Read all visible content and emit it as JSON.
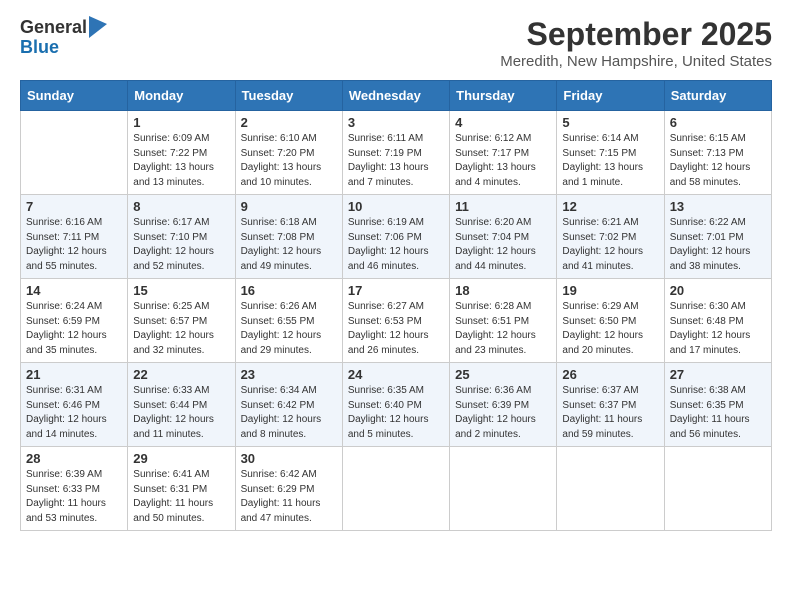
{
  "logo": {
    "general": "General",
    "blue": "Blue"
  },
  "title": "September 2025",
  "location": "Meredith, New Hampshire, United States",
  "days_of_week": [
    "Sunday",
    "Monday",
    "Tuesday",
    "Wednesday",
    "Thursday",
    "Friday",
    "Saturday"
  ],
  "weeks": [
    [
      {
        "day": "",
        "info": ""
      },
      {
        "day": "1",
        "info": "Sunrise: 6:09 AM\nSunset: 7:22 PM\nDaylight: 13 hours\nand 13 minutes."
      },
      {
        "day": "2",
        "info": "Sunrise: 6:10 AM\nSunset: 7:20 PM\nDaylight: 13 hours\nand 10 minutes."
      },
      {
        "day": "3",
        "info": "Sunrise: 6:11 AM\nSunset: 7:19 PM\nDaylight: 13 hours\nand 7 minutes."
      },
      {
        "day": "4",
        "info": "Sunrise: 6:12 AM\nSunset: 7:17 PM\nDaylight: 13 hours\nand 4 minutes."
      },
      {
        "day": "5",
        "info": "Sunrise: 6:14 AM\nSunset: 7:15 PM\nDaylight: 13 hours\nand 1 minute."
      },
      {
        "day": "6",
        "info": "Sunrise: 6:15 AM\nSunset: 7:13 PM\nDaylight: 12 hours\nand 58 minutes."
      }
    ],
    [
      {
        "day": "7",
        "info": "Sunrise: 6:16 AM\nSunset: 7:11 PM\nDaylight: 12 hours\nand 55 minutes."
      },
      {
        "day": "8",
        "info": "Sunrise: 6:17 AM\nSunset: 7:10 PM\nDaylight: 12 hours\nand 52 minutes."
      },
      {
        "day": "9",
        "info": "Sunrise: 6:18 AM\nSunset: 7:08 PM\nDaylight: 12 hours\nand 49 minutes."
      },
      {
        "day": "10",
        "info": "Sunrise: 6:19 AM\nSunset: 7:06 PM\nDaylight: 12 hours\nand 46 minutes."
      },
      {
        "day": "11",
        "info": "Sunrise: 6:20 AM\nSunset: 7:04 PM\nDaylight: 12 hours\nand 44 minutes."
      },
      {
        "day": "12",
        "info": "Sunrise: 6:21 AM\nSunset: 7:02 PM\nDaylight: 12 hours\nand 41 minutes."
      },
      {
        "day": "13",
        "info": "Sunrise: 6:22 AM\nSunset: 7:01 PM\nDaylight: 12 hours\nand 38 minutes."
      }
    ],
    [
      {
        "day": "14",
        "info": "Sunrise: 6:24 AM\nSunset: 6:59 PM\nDaylight: 12 hours\nand 35 minutes."
      },
      {
        "day": "15",
        "info": "Sunrise: 6:25 AM\nSunset: 6:57 PM\nDaylight: 12 hours\nand 32 minutes."
      },
      {
        "day": "16",
        "info": "Sunrise: 6:26 AM\nSunset: 6:55 PM\nDaylight: 12 hours\nand 29 minutes."
      },
      {
        "day": "17",
        "info": "Sunrise: 6:27 AM\nSunset: 6:53 PM\nDaylight: 12 hours\nand 26 minutes."
      },
      {
        "day": "18",
        "info": "Sunrise: 6:28 AM\nSunset: 6:51 PM\nDaylight: 12 hours\nand 23 minutes."
      },
      {
        "day": "19",
        "info": "Sunrise: 6:29 AM\nSunset: 6:50 PM\nDaylight: 12 hours\nand 20 minutes."
      },
      {
        "day": "20",
        "info": "Sunrise: 6:30 AM\nSunset: 6:48 PM\nDaylight: 12 hours\nand 17 minutes."
      }
    ],
    [
      {
        "day": "21",
        "info": "Sunrise: 6:31 AM\nSunset: 6:46 PM\nDaylight: 12 hours\nand 14 minutes."
      },
      {
        "day": "22",
        "info": "Sunrise: 6:33 AM\nSunset: 6:44 PM\nDaylight: 12 hours\nand 11 minutes."
      },
      {
        "day": "23",
        "info": "Sunrise: 6:34 AM\nSunset: 6:42 PM\nDaylight: 12 hours\nand 8 minutes."
      },
      {
        "day": "24",
        "info": "Sunrise: 6:35 AM\nSunset: 6:40 PM\nDaylight: 12 hours\nand 5 minutes."
      },
      {
        "day": "25",
        "info": "Sunrise: 6:36 AM\nSunset: 6:39 PM\nDaylight: 12 hours\nand 2 minutes."
      },
      {
        "day": "26",
        "info": "Sunrise: 6:37 AM\nSunset: 6:37 PM\nDaylight: 11 hours\nand 59 minutes."
      },
      {
        "day": "27",
        "info": "Sunrise: 6:38 AM\nSunset: 6:35 PM\nDaylight: 11 hours\nand 56 minutes."
      }
    ],
    [
      {
        "day": "28",
        "info": "Sunrise: 6:39 AM\nSunset: 6:33 PM\nDaylight: 11 hours\nand 53 minutes."
      },
      {
        "day": "29",
        "info": "Sunrise: 6:41 AM\nSunset: 6:31 PM\nDaylight: 11 hours\nand 50 minutes."
      },
      {
        "day": "30",
        "info": "Sunrise: 6:42 AM\nSunset: 6:29 PM\nDaylight: 11 hours\nand 47 minutes."
      },
      {
        "day": "",
        "info": ""
      },
      {
        "day": "",
        "info": ""
      },
      {
        "day": "",
        "info": ""
      },
      {
        "day": "",
        "info": ""
      }
    ]
  ]
}
